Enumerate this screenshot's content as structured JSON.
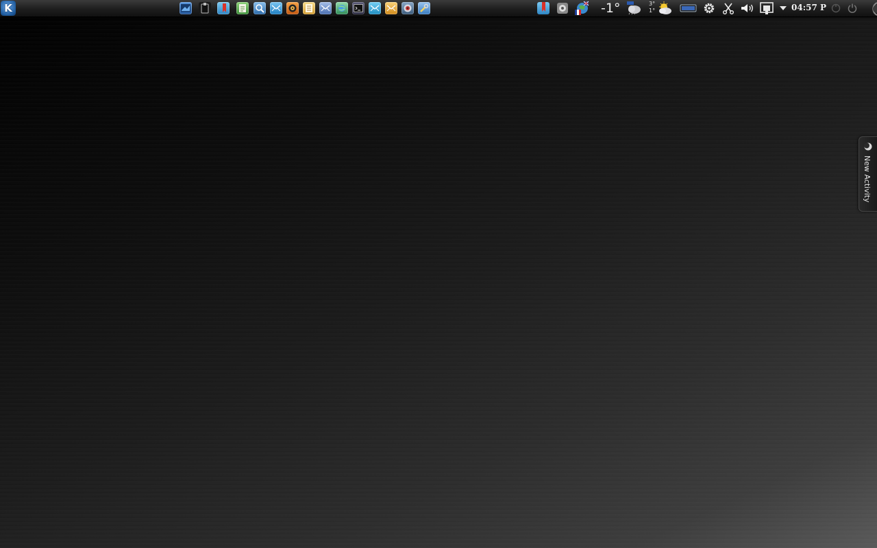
{
  "panel": {
    "launchers": [
      {
        "icon": "desktop-settings-icon",
        "color": "#3a78c0"
      },
      {
        "icon": "clipboard-icon",
        "color": "#2a2a2a"
      },
      {
        "icon": "bookmark-icon",
        "color": "#4aa3d8"
      },
      {
        "icon": "document-editor-icon",
        "color": "#5bb050"
      },
      {
        "icon": "image-viewer-icon",
        "color": "#3f86c6"
      },
      {
        "icon": "mail-icon",
        "color": "#3b9ad8"
      },
      {
        "icon": "media-player-icon",
        "color": "#e0781e"
      },
      {
        "icon": "notes-icon",
        "color": "#e8c060"
      },
      {
        "icon": "file-manager-icon",
        "color": "#6a8fc8"
      },
      {
        "icon": "network-icon",
        "color": "#4cae7a"
      },
      {
        "icon": "terminal-icon",
        "color": "#3a3a55"
      },
      {
        "icon": "tools-icon",
        "color": "#38a8d8"
      },
      {
        "icon": "archive-icon",
        "color": "#f0b040"
      },
      {
        "icon": "disc-burner-icon",
        "color": "#5a7a9a"
      },
      {
        "icon": "system-tools-icon",
        "color": "#6aa0d8"
      }
    ],
    "tray": {
      "temperature": "-1",
      "degree_symbol": "°",
      "forecast_high": "3°",
      "forecast_low": "1°",
      "clock": "04:57 P",
      "icons": [
        "bookmark-tray-icon",
        "printer-queue-icon",
        "keyboard-layout-icon",
        "weather-cloudy-icon",
        "weather-partly-sunny-icon",
        "battery-icon",
        "settings-gear-icon",
        "scissors-clipboard-icon",
        "volume-icon",
        "network-manager-icon",
        "expand-arrow-icon",
        "lock-screen-icon",
        "power-icon"
      ]
    }
  },
  "activity": {
    "label": "New Activity"
  },
  "colors": {
    "panel_bg": "#1e1e1e",
    "desktop_dark": "#000000",
    "desktop_light": "#5a5a5a"
  }
}
